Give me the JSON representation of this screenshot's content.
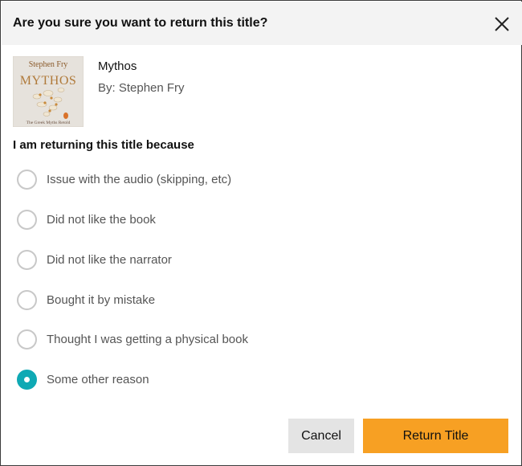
{
  "dialog": {
    "title": "Are you sure you want to return this title?",
    "close_icon": "close-icon"
  },
  "book": {
    "cover_author": "Stephen Fry",
    "cover_title": "MYTHOS",
    "cover_subtitle": "The Greek Myths Retold",
    "title": "Mythos",
    "author_line": "By: Stephen Fry"
  },
  "reasons": {
    "label": "I am returning this title because",
    "options": [
      {
        "label": "Issue with the audio (skipping, etc)",
        "checked": false
      },
      {
        "label": "Did not like the book",
        "checked": false
      },
      {
        "label": "Did not like the narrator",
        "checked": false
      },
      {
        "label": "Bought it by mistake",
        "checked": false
      },
      {
        "label": "Thought I was getting a physical book",
        "checked": false
      },
      {
        "label": "Some other reason",
        "checked": true
      }
    ]
  },
  "actions": {
    "cancel_label": "Cancel",
    "return_label": "Return Title"
  },
  "colors": {
    "accent_radio": "#0fa9b4",
    "primary_button": "#f7a023",
    "secondary_button": "#e4e4e4",
    "header_bg": "#f3f3f3"
  }
}
